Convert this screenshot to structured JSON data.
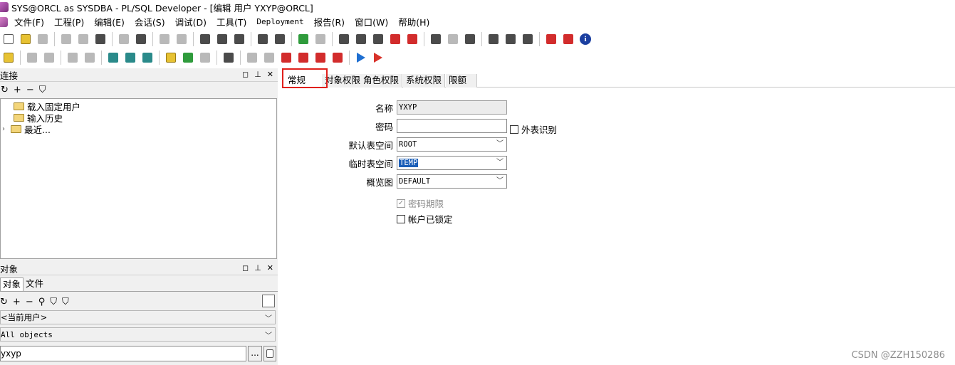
{
  "window": {
    "title": "SYS@ORCL as SYSDBA - PL/SQL Developer - [编辑 用户 YXYP@ORCL]"
  },
  "menu": [
    {
      "label": "文件(F)"
    },
    {
      "label": "工程(P)"
    },
    {
      "label": "编辑(E)"
    },
    {
      "label": "会话(S)"
    },
    {
      "label": "调试(D)"
    },
    {
      "label": "工具(T)"
    },
    {
      "label": "Deployment"
    },
    {
      "label": "报告(R)"
    },
    {
      "label": "窗口(W)"
    },
    {
      "label": "帮助(H)"
    }
  ],
  "connections_panel": {
    "title": "连接",
    "tree": [
      {
        "label": "载入固定用户"
      },
      {
        "label": "输入历史"
      },
      {
        "label": "最近..."
      }
    ]
  },
  "objects_panel": {
    "title": "对象",
    "tabs": [
      "对象",
      "文件"
    ],
    "user_select": "<当前用户>",
    "object_filter": "All objects",
    "search_value": "yxyp",
    "dots_label": "..."
  },
  "panel_controls": {
    "pin": "◻",
    "dock": "⊥",
    "close": "✕"
  },
  "editor": {
    "tabs": [
      "常规",
      "对象权限",
      "角色权限",
      "系统权限",
      "限额"
    ],
    "active_tab": "常规",
    "form": {
      "name_label": "名称",
      "name_value": "YXYP",
      "password_label": "密码",
      "password_value": "",
      "external_label": "外表识别",
      "default_ts_label": "默认表空间",
      "default_ts_value": "ROOT",
      "temp_ts_label": "临时表空间",
      "temp_ts_value": "TEMP",
      "profile_label": "概览图",
      "profile_value": "DEFAULT",
      "password_expire_label": "密码期限",
      "account_locked_label": "帐户已锁定"
    }
  },
  "watermark": "CSDN @ZZH150286",
  "colors": {
    "highlight_border": "#e0201c",
    "selection": "#1c5fb8"
  }
}
